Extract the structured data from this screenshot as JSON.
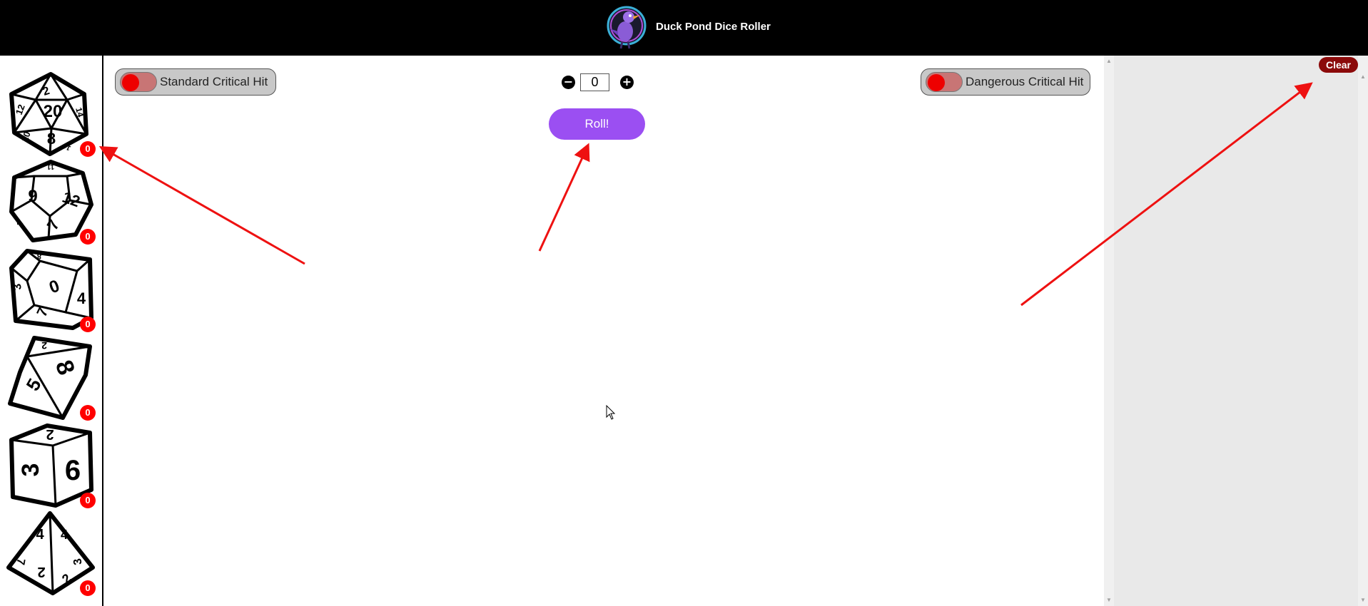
{
  "header": {
    "title": "Duck Pond Dice Roller"
  },
  "dice": [
    {
      "icon": "d20-icon",
      "faces": [
        "2",
        "20",
        "12",
        "14",
        "10",
        "8",
        "16"
      ],
      "count": "0"
    },
    {
      "icon": "d12-icon",
      "faces": [
        "11",
        "9",
        "12",
        "7",
        "3"
      ],
      "count": "0"
    },
    {
      "icon": "d10-icon",
      "faces": [
        "8",
        "0",
        "3",
        "4",
        "7"
      ],
      "count": "0"
    },
    {
      "icon": "d8-icon",
      "faces": [
        "2",
        "8",
        "5"
      ],
      "count": "0"
    },
    {
      "icon": "d6-icon",
      "faces": [
        "2",
        "3",
        "6"
      ],
      "count": "0"
    },
    {
      "icon": "d4-icon",
      "faces": [
        "4",
        "4",
        "2",
        "3",
        "7",
        "2"
      ],
      "count": "0"
    }
  ],
  "toggles": {
    "standard": "Standard Critical Hit",
    "dangerous": "Dangerous Critical Hit"
  },
  "modifier": {
    "value": "0",
    "minus": "−",
    "plus": "+"
  },
  "roll_button": "Roll!",
  "log": {
    "clear_label": "Clear"
  },
  "colors": {
    "header_bg": "#000000",
    "roll_button": "#9b4ff2",
    "badge": "#ff0000",
    "clear_button": "#8b0a0a",
    "log_panel_bg": "#e9e9e9",
    "toggle_knob": "#ee0000",
    "annotation_arrow": "#ee1111"
  }
}
